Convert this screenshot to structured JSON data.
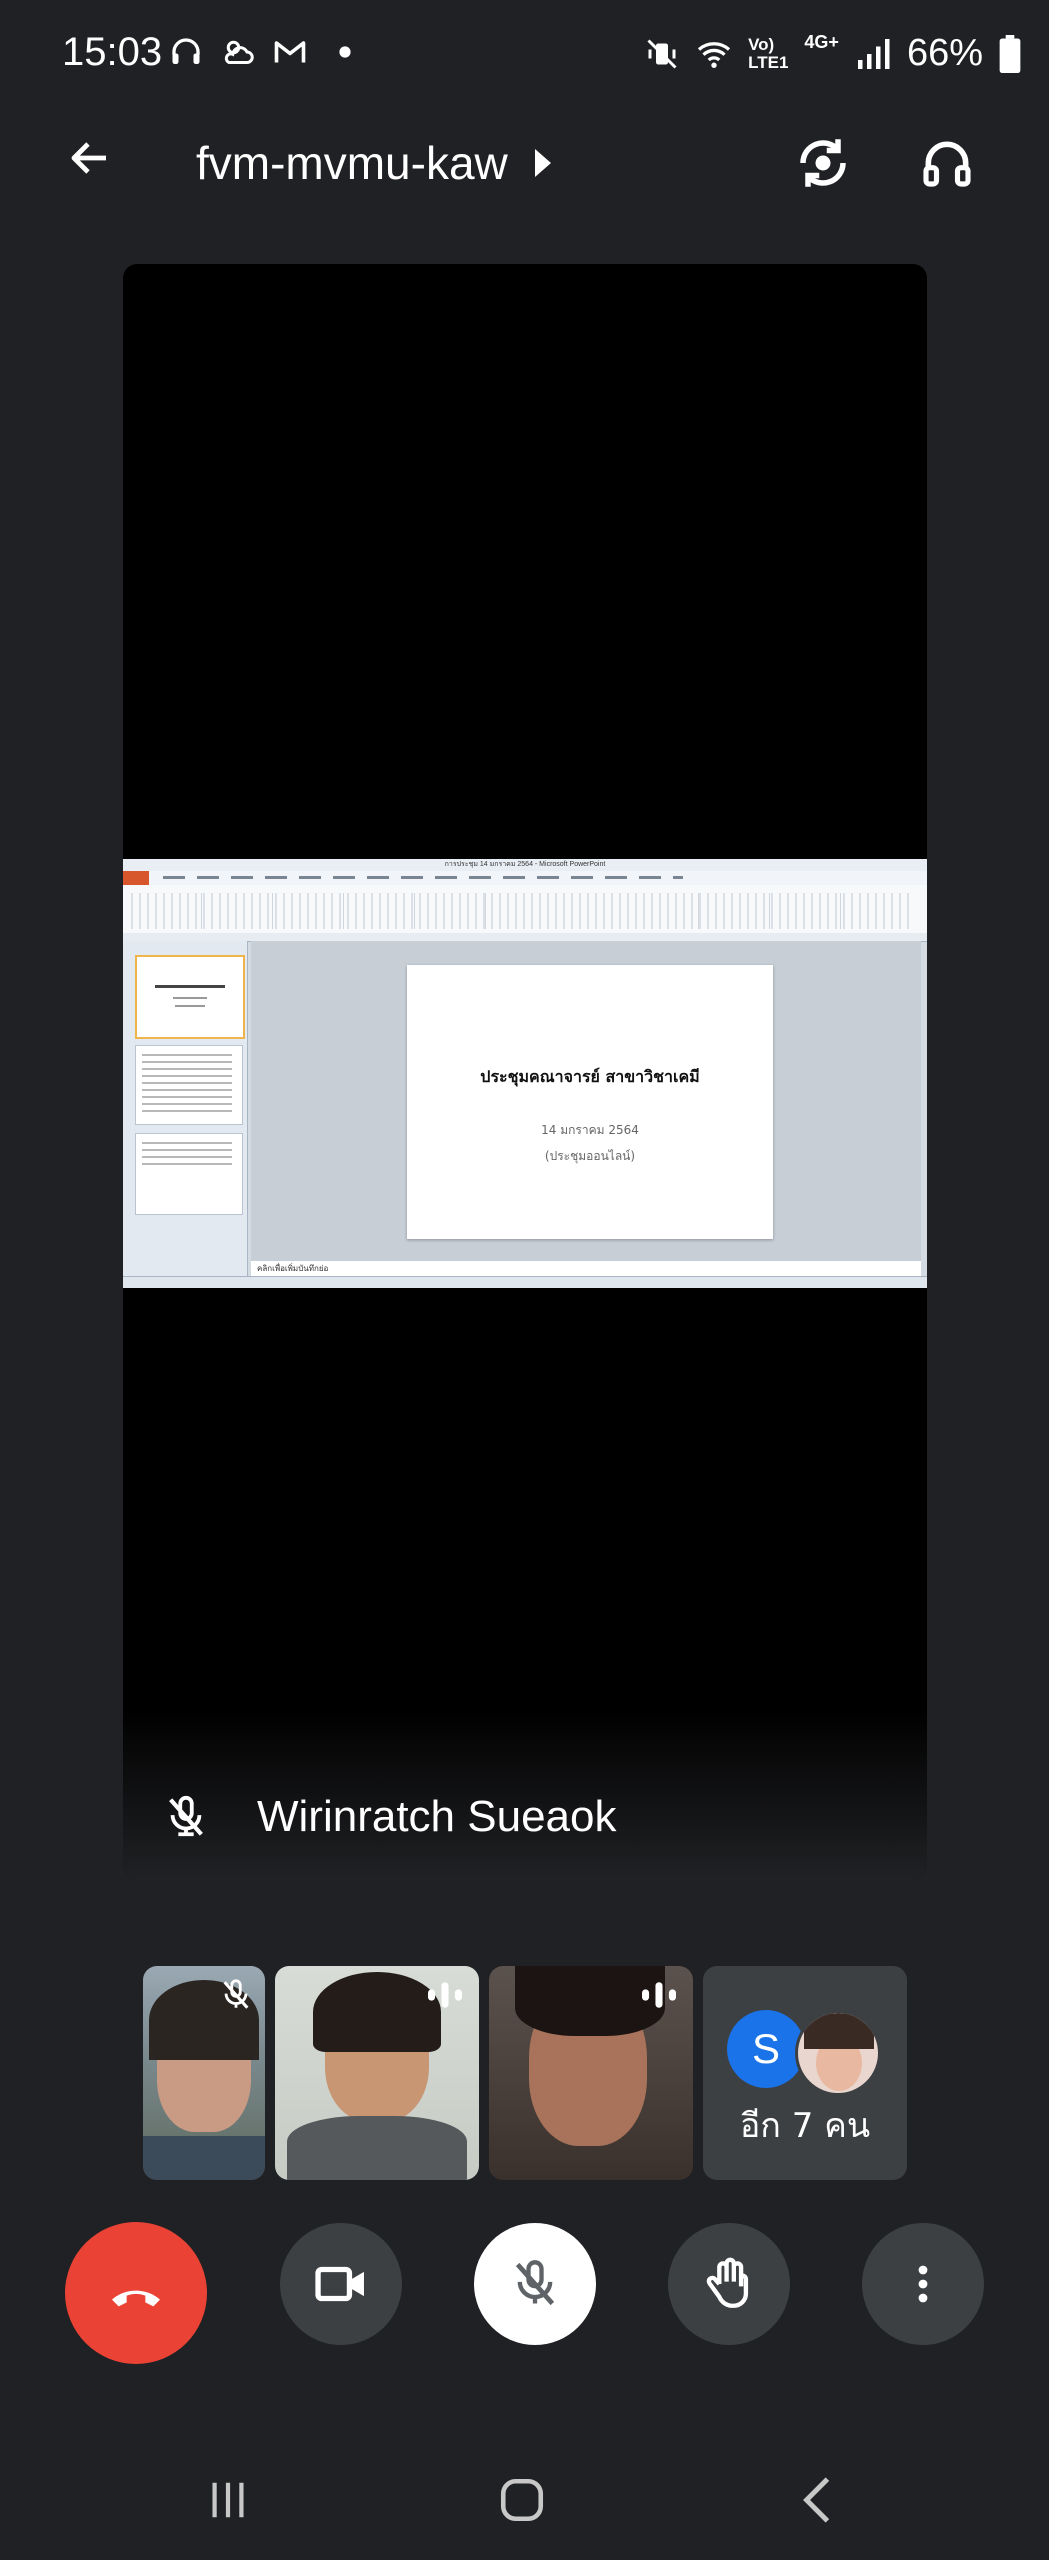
{
  "status_bar": {
    "time": "15:03",
    "left_icons": [
      "headphones-icon",
      "weather-icon",
      "gmail-icon",
      "dot-icon"
    ],
    "network_label_top": "Vo)",
    "network_label_bottom": "LTE1",
    "mobile_gen": "4G+",
    "battery": "66%"
  },
  "header": {
    "meeting_code": "fvm-mvmu-kaw"
  },
  "main_tile": {
    "presenter_name": "Wirinratch Sueaok",
    "shared_screen": {
      "window_title": "การประชุม 14 มกราคม 2564 - Microsoft PowerPoint",
      "slide_title": "ประชุมคณาจารย์ สาขาวิชาเคมี",
      "slide_date": "14 มกราคม 2564",
      "slide_note": "(ประชุมออนไลน์)",
      "notes_placeholder": "คลิกเพื่อเพิ่มบันทึกย่อ"
    }
  },
  "participants": {
    "more_initial": "S",
    "more_label": "อีก 7 คน"
  },
  "colors": {
    "background": "#202124",
    "hangup": "#ea4335",
    "tile": "#3c4043",
    "avatar_blue": "#1a73e8"
  }
}
